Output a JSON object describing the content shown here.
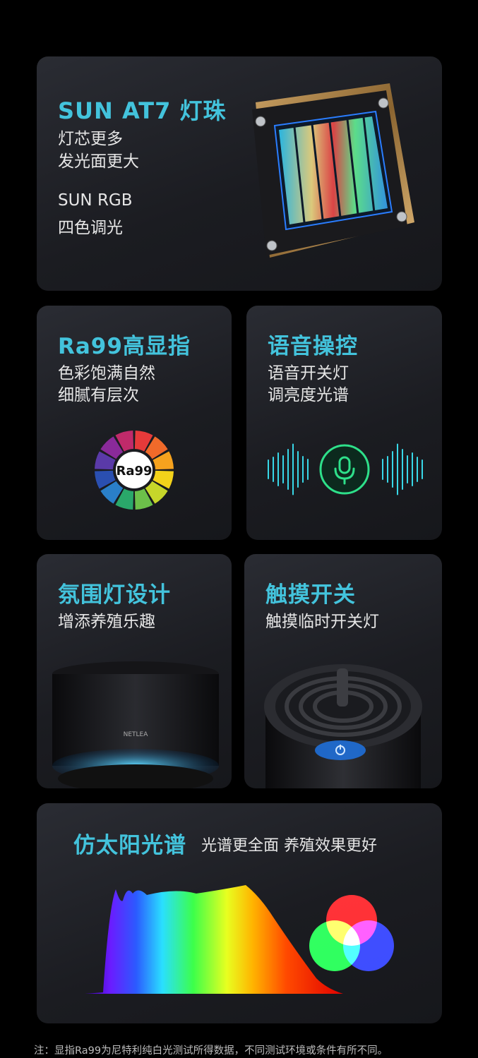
{
  "card_led": {
    "title": "SUN AT7 灯珠",
    "line1": "灯芯更多",
    "line2": "发光面更大",
    "line3": "SUN RGB",
    "line4": "四色调光"
  },
  "card_ra": {
    "title": "Ra99高显指",
    "line1": "色彩饱满自然",
    "line2": "细腻有层次",
    "badge": "Ra99"
  },
  "card_voice": {
    "title": "语音操控",
    "line1": "语音开关灯",
    "line2": "调亮度光谱"
  },
  "card_ambient": {
    "title": "氛围灯设计",
    "line1": "增添养殖乐趣",
    "logo": "NETLEA"
  },
  "card_touch": {
    "title": "触摸开关",
    "line1": "触摸临时开关灯"
  },
  "card_spectrum": {
    "title": "仿太阳光谱",
    "subtitle": "光谱更全面 养殖效果更好"
  },
  "footnote": "注：显指Ra99为尼特利纯白光测试所得数据，不同测试环境或条件有所不同。",
  "colors": {
    "accent": "#43c3dc",
    "mic_green": "#2ee08a",
    "wave_cyan": "#38d8e8"
  },
  "icons": [
    "led-chip-image",
    "color-wheel-icon",
    "microphone-icon",
    "power-icon"
  ]
}
